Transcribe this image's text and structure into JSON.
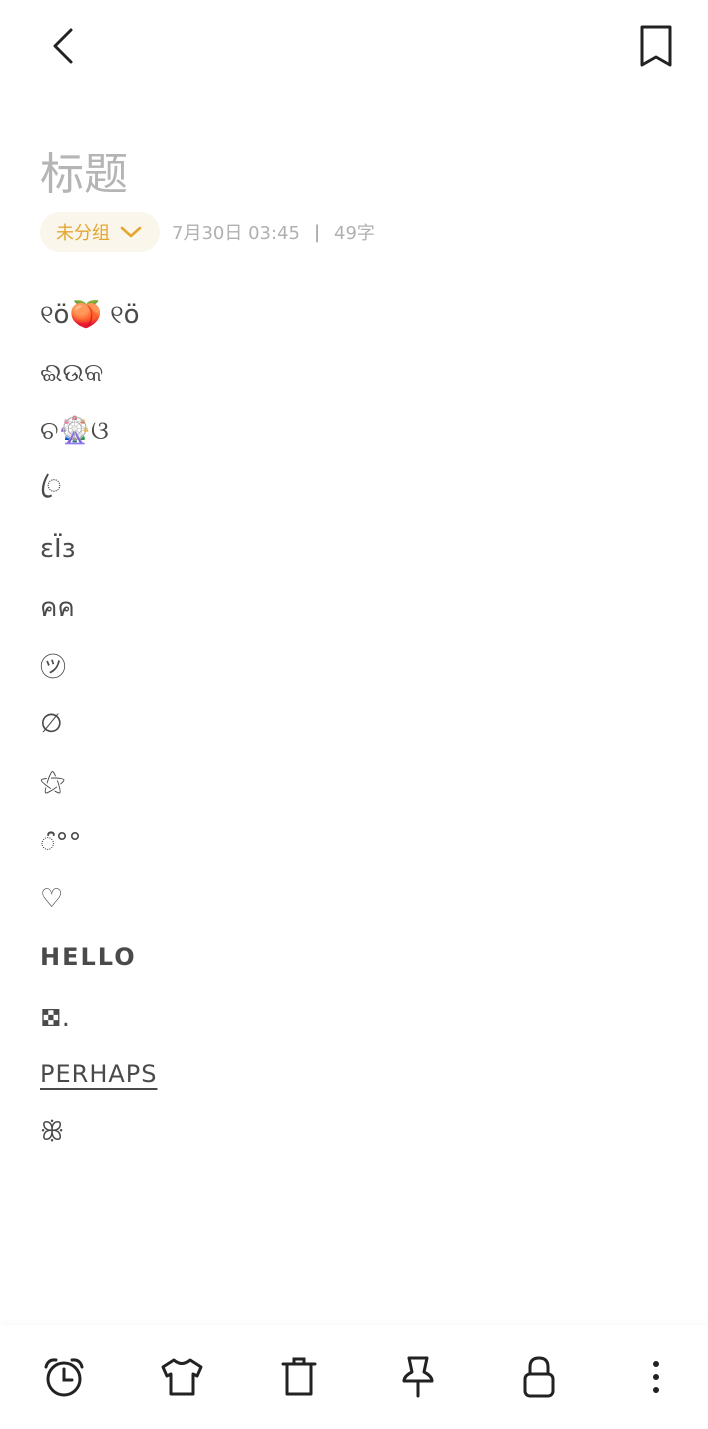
{
  "header": {
    "back_icon": "chevron-left-icon",
    "bookmark_icon": "bookmark-icon"
  },
  "note": {
    "title_placeholder": "标题",
    "group_label": "未分组",
    "date": "7月30日 03:45",
    "separator": "|",
    "char_count": "49字",
    "lines": [
      "୧ӧ🍑 ୧ӧ",
      "ଈଉକ",
      "ଚ🎡ଓ",
      "ꦿ",
      "ɛÏɜ",
      "คค",
      "㋡",
      "∅",
      "⚝",
      "ꢶ°°",
      "♡",
      "HELLO",
      "𖣯.",
      "PERHAPS",
      "ꕥ"
    ]
  },
  "toolbar": {
    "items": [
      "alarm-clock-icon",
      "tshirt-icon",
      "trash-icon",
      "pin-icon",
      "lock-icon",
      "more-vertical-icon"
    ]
  }
}
